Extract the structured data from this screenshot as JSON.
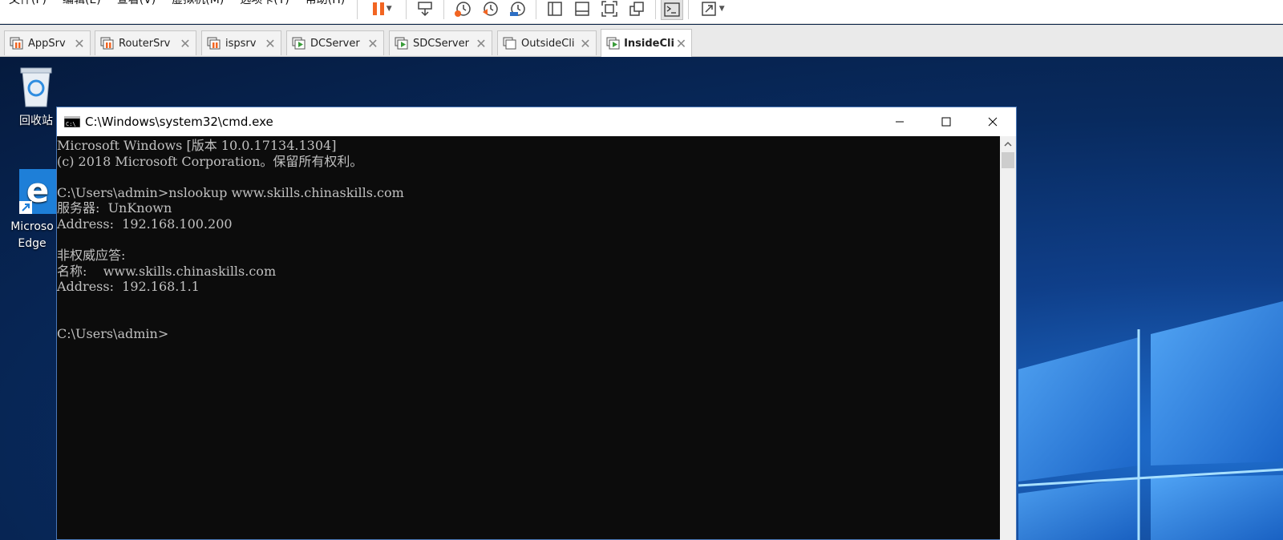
{
  "menubar": {
    "items": [
      "文件(F)",
      "编辑(E)",
      "查看(V)",
      "虚拟机(M)",
      "选项卡(T)",
      "帮助(H)"
    ],
    "toolbar_icons": [
      "pause-icon",
      "send-keys-icon",
      "snapshot-icon",
      "revert-snapshot-icon",
      "snapshot-manager-icon",
      "sidebar-icon",
      "thumbnail-icon",
      "fullscreen-icon",
      "unity-icon",
      "console-icon",
      "stretch-icon"
    ]
  },
  "tabs": [
    {
      "label": "AppSrv",
      "state": "running"
    },
    {
      "label": "RouterSrv",
      "state": "running"
    },
    {
      "label": "ispsrv",
      "state": "running"
    },
    {
      "label": "DCServer",
      "state": "powered"
    },
    {
      "label": "SDCServer",
      "state": "powered"
    },
    {
      "label": "OutsideCli",
      "state": "off"
    },
    {
      "label": "InsideCli",
      "state": "powered",
      "active": true
    }
  ],
  "desktop": {
    "recycle_bin_label": "回收站",
    "edge_label_line1": "Microso",
    "edge_label_line2": "Edge"
  },
  "cmd": {
    "title": "C:\\Windows\\system32\\cmd.exe",
    "lines": [
      "Microsoft Windows [版本 10.0.17134.1304]",
      "(c) 2018 Microsoft Corporation。保留所有权利。",
      "",
      "C:\\Users\\admin>nslookup www.skills.chinaskills.com",
      "服务器:  UnKnown",
      "Address:  192.168.100.200",
      "",
      "非权威应答:",
      "名称:    www.skills.chinaskills.com",
      "Address:  192.168.1.1",
      "",
      "",
      "C:\\Users\\admin>"
    ]
  },
  "colors": {
    "console_bg": "#0c0c0c",
    "console_fg": "#c0c0c0",
    "pause_orange": "#f26522",
    "running_green": "#3a9d3a"
  }
}
